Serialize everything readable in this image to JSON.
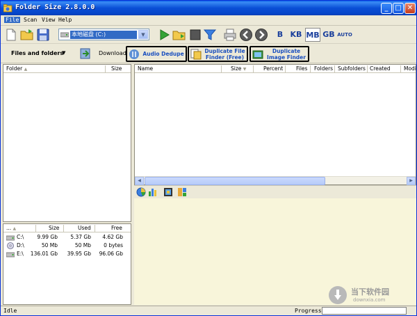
{
  "window": {
    "title": "Folder Size 2.8.0.0"
  },
  "menu": [
    "File",
    "Scan",
    "View",
    "Help"
  ],
  "toolbar": {
    "drive_selected": "本地磁盘 (C:)",
    "units": [
      "B",
      "KB",
      "MB",
      "GB",
      "AUTO"
    ],
    "active_unit": "MB"
  },
  "toolbar2": {
    "view_mode": "Files and folders",
    "download_label": "Download:",
    "promos": [
      {
        "line1": "Audio Dedupe",
        "line2": ""
      },
      {
        "line1": "Duplicate File",
        "line2": "Finder (Free)"
      },
      {
        "line1": "Duplicate",
        "line2": "Image Finder"
      }
    ]
  },
  "folder_tree": {
    "columns": [
      "Folder",
      "Size"
    ]
  },
  "file_list": {
    "columns": [
      "Name",
      "Size",
      "Percent",
      "Files",
      "Folders",
      "Subfolders",
      "Created",
      "Modi"
    ]
  },
  "drives": {
    "columns": [
      "...",
      "Size",
      "Used",
      "Free"
    ],
    "rows": [
      {
        "name": "C:\\",
        "size": "9.99 Gb",
        "used": "5.37 Gb",
        "free": "4.62 Gb",
        "icon": "hard-drive-icon"
      },
      {
        "name": "D:\\",
        "size": "50 Mb",
        "used": "50 Mb",
        "free": "0 bytes",
        "icon": "cd-drive-icon"
      },
      {
        "name": "E:\\",
        "size": "136.01 Gb",
        "used": "39.95 Gb",
        "free": "96.06 Gb",
        "icon": "hard-drive-icon"
      }
    ]
  },
  "status": {
    "text": "Idle",
    "progress_label": "Progress:"
  },
  "watermark": {
    "text": "当下软件园",
    "url": "downxia.com"
  }
}
